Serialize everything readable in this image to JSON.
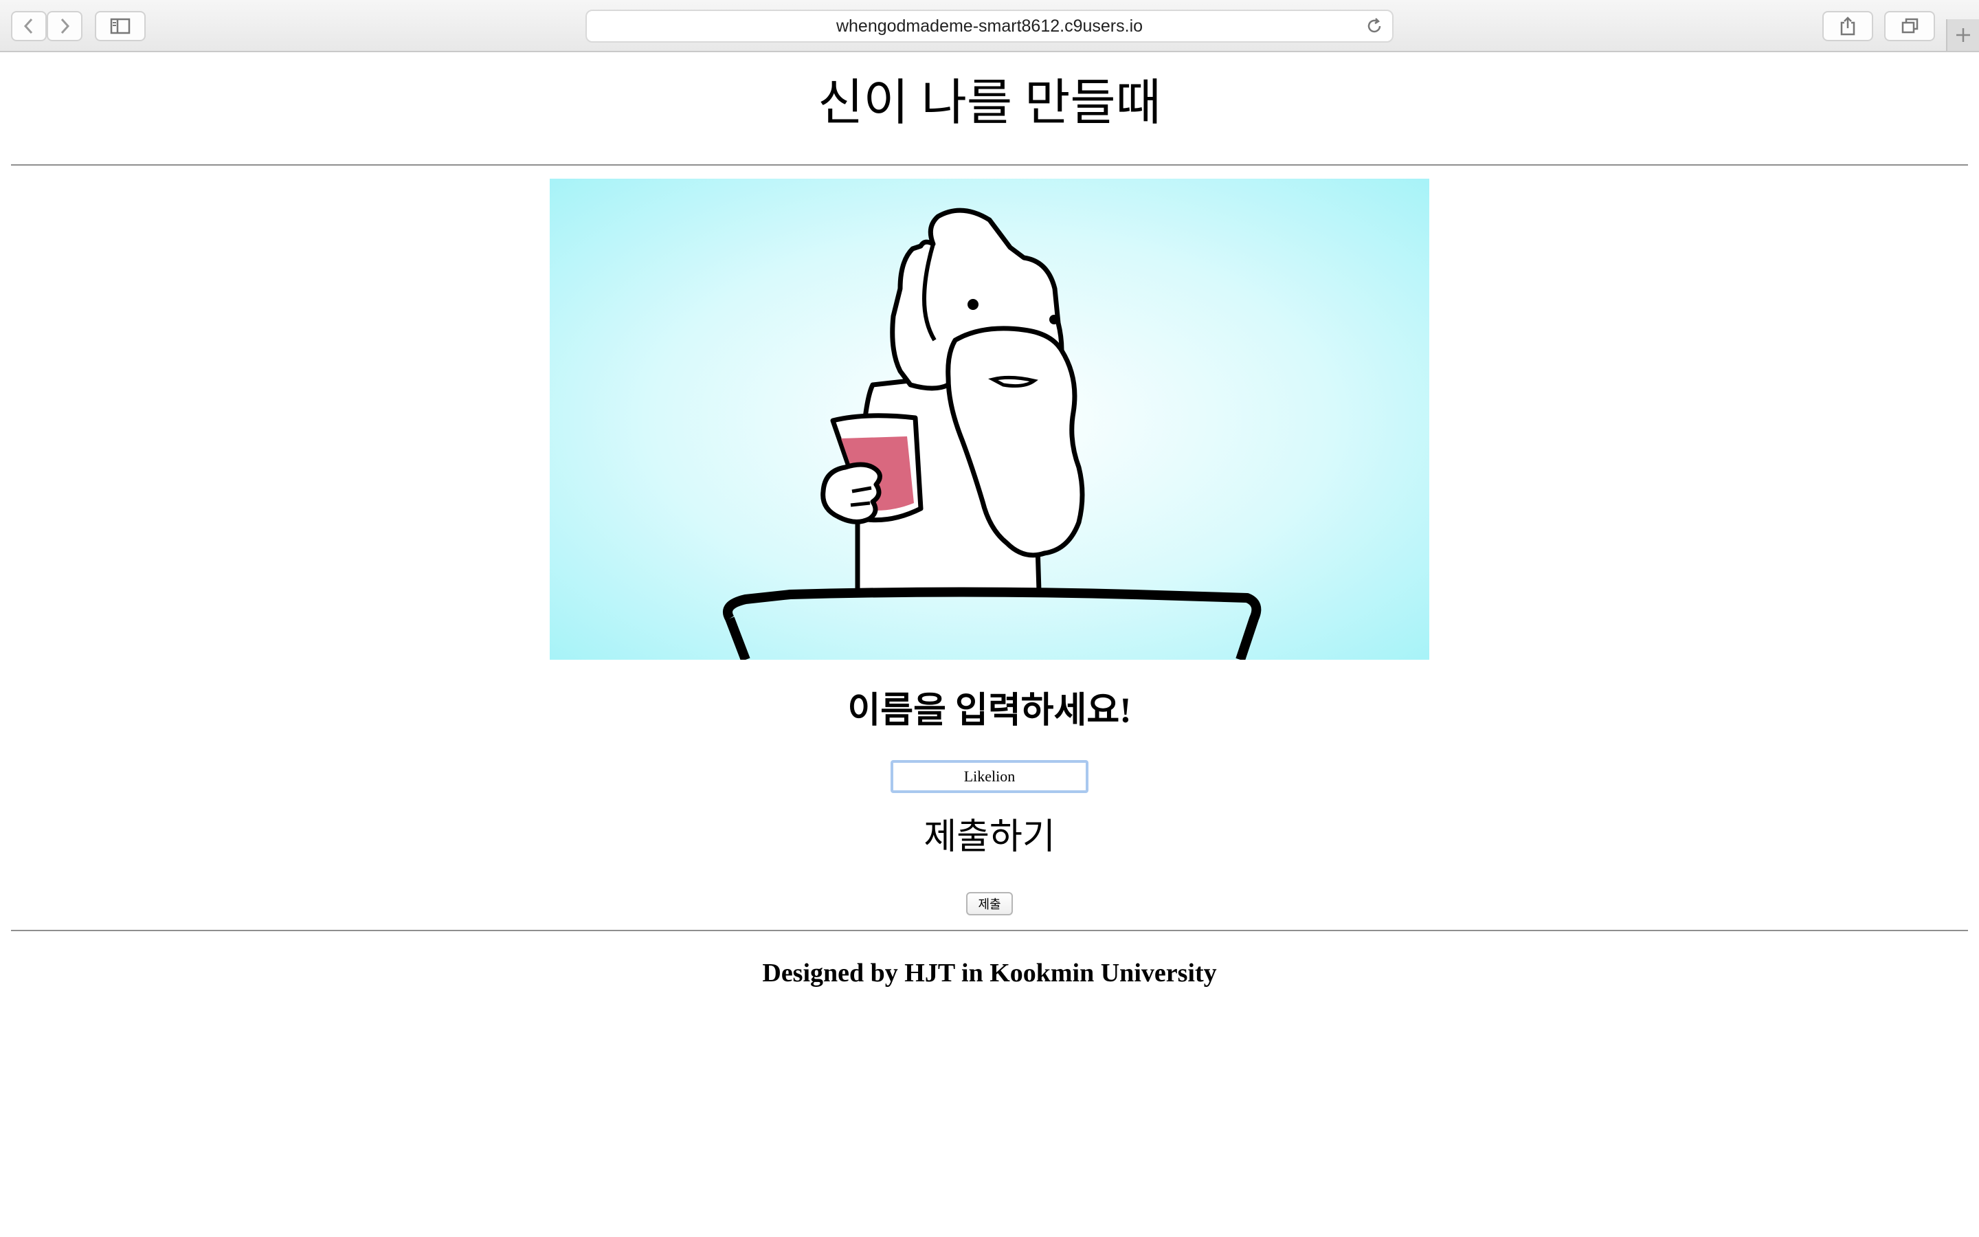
{
  "browser": {
    "url": "whengodmademe-smart8612.c9users.io"
  },
  "page": {
    "title": "신이 나를 만들때",
    "name_prompt": "이름을 입력하세요!",
    "name_input_value": "Likelion",
    "submit_heading": "제출하기",
    "submit_button_label": "제출",
    "footer": "Designed by HJT in Kookmin University"
  },
  "image": {
    "subject": "cartoon-god-with-beard-holding-cup",
    "background_color": "#a8f3f8",
    "cup_color": "#d9687f"
  }
}
